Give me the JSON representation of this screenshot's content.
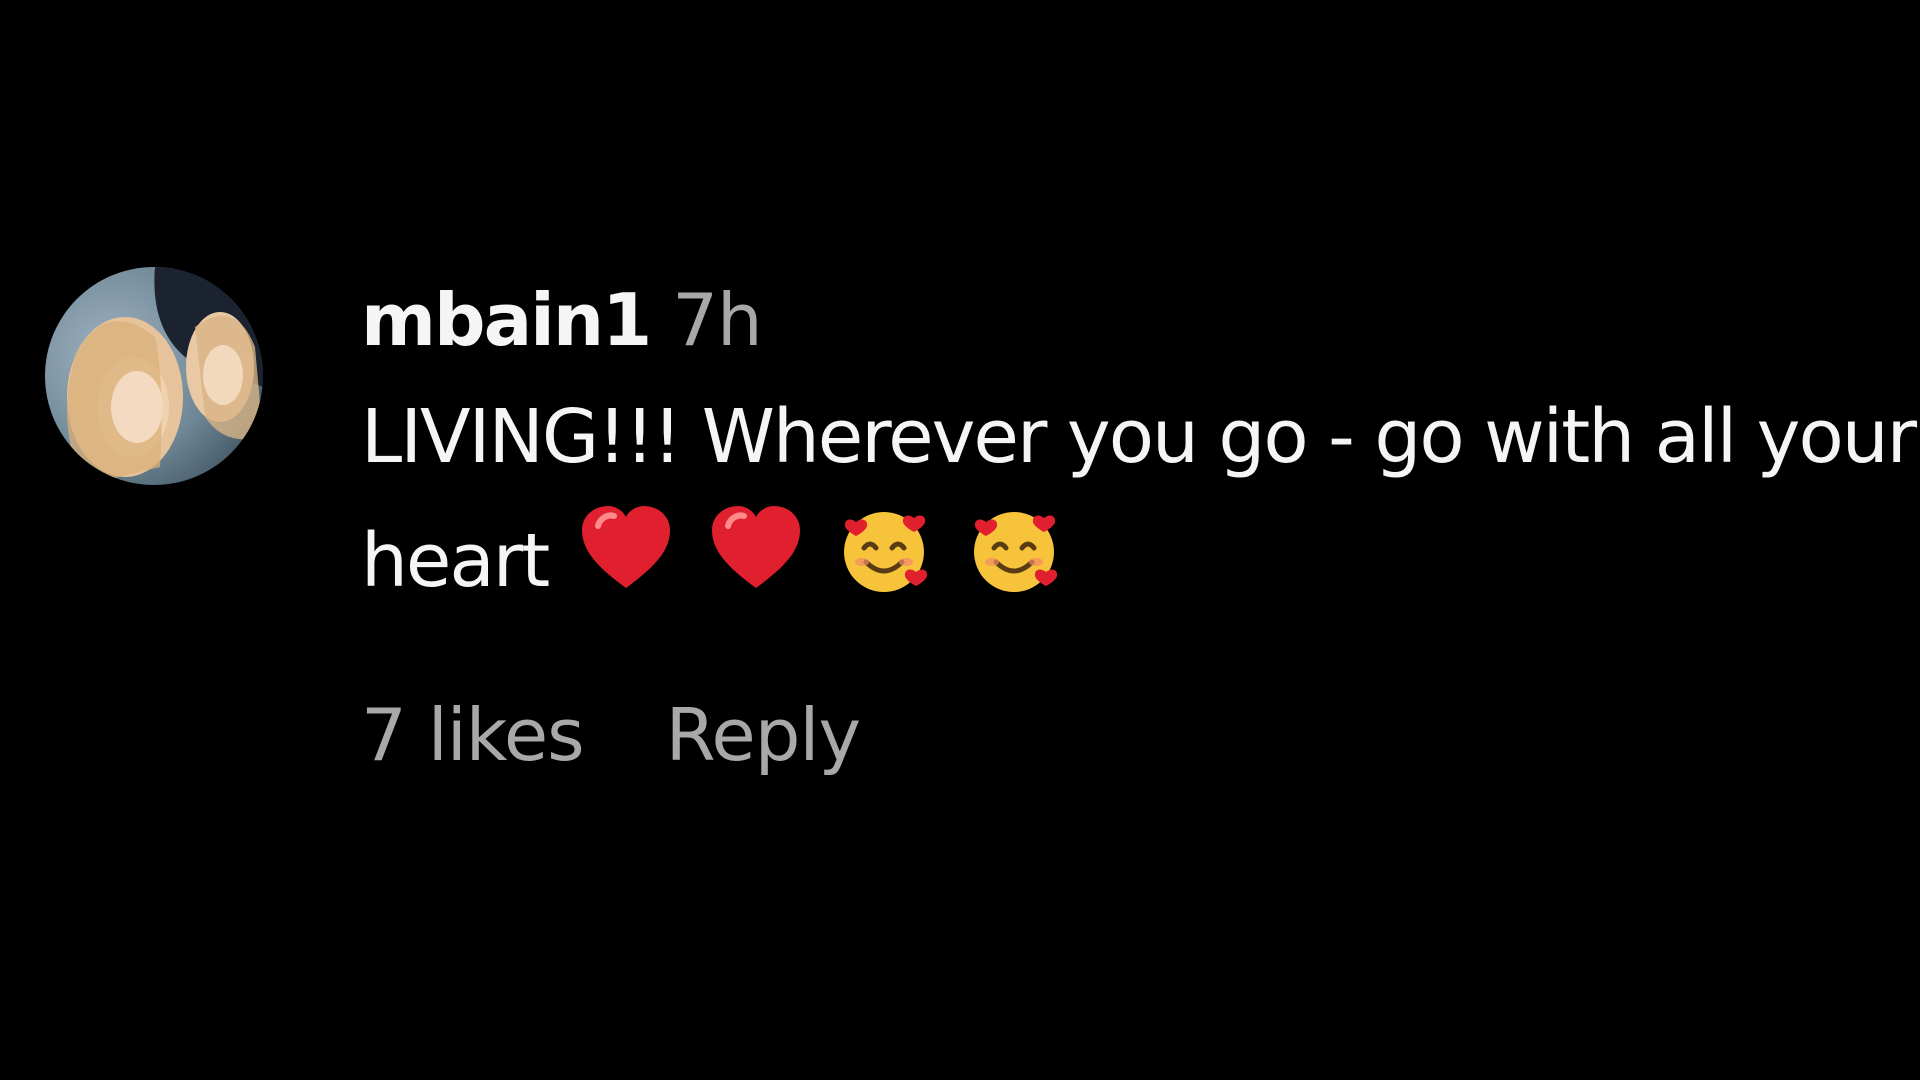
{
  "comment": {
    "avatar_icon": "user-avatar-photo",
    "username": "mbain1",
    "timestamp": "7h",
    "text": "LIVING!!! Wherever you go - go with all your heart",
    "emojis": [
      "red-heart-icon",
      "red-heart-icon",
      "smiling-face-with-hearts-icon",
      "smiling-face-with-hearts-icon"
    ],
    "likes_label": "7 likes",
    "reply_label": "Reply"
  },
  "colors": {
    "background": "#000000",
    "primary_text": "#f5f5f5",
    "secondary_text": "#a8a8a8",
    "heart_red": "#e0202e",
    "emoji_yellow": "#f7c33b"
  }
}
